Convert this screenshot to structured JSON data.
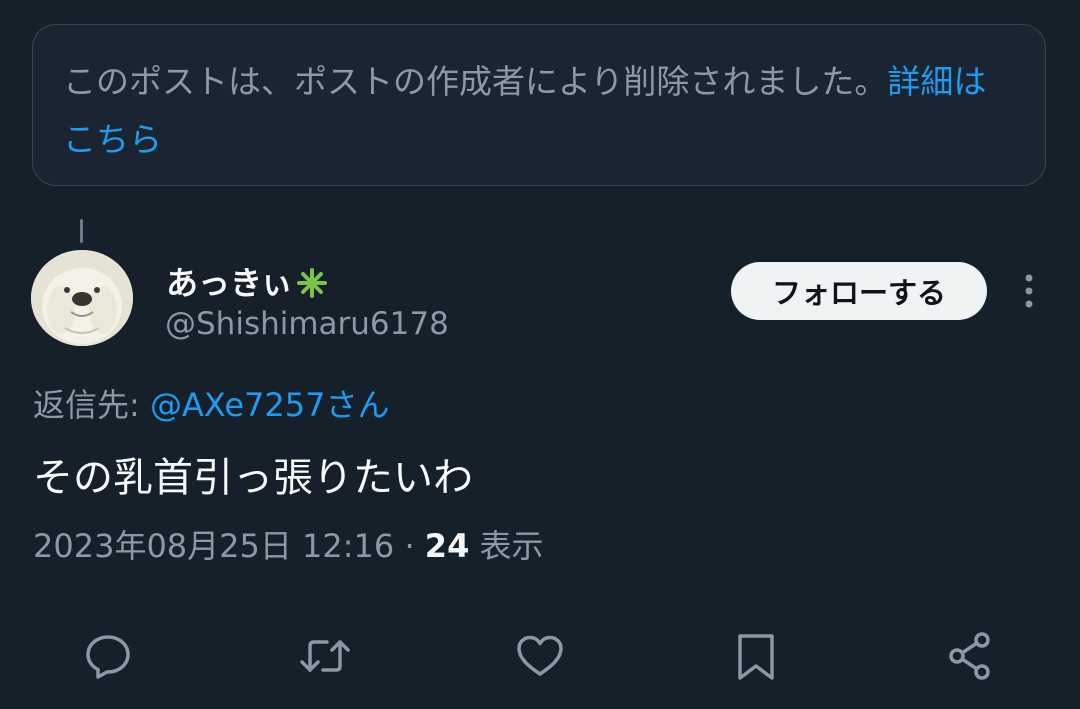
{
  "deleted_notice": {
    "text": "このポストは、ポストの作成者により削除されました。",
    "link_label": "詳細はこちら"
  },
  "author": {
    "display_name": "あっきぃ",
    "badge_icon": "sparkle-icon",
    "badge_color": "#7cc447",
    "handle": "@Shishimaru6178",
    "follow_label": "フォローする"
  },
  "reply": {
    "prefix": "返信先: ",
    "handle": "@AXe7257さん"
  },
  "tweet": {
    "text": "その乳首引っ張りたいわ",
    "timestamp": "2023年08月25日 12:16",
    "separator": "·",
    "views": "24",
    "views_label": "表示"
  },
  "actions": [
    "reply-icon",
    "retweet-icon",
    "like-icon",
    "bookmark-icon",
    "share-icon"
  ],
  "colors": {
    "background": "#15202b",
    "accent": "#1d9bf0",
    "secondary_text": "#8b98a5"
  }
}
